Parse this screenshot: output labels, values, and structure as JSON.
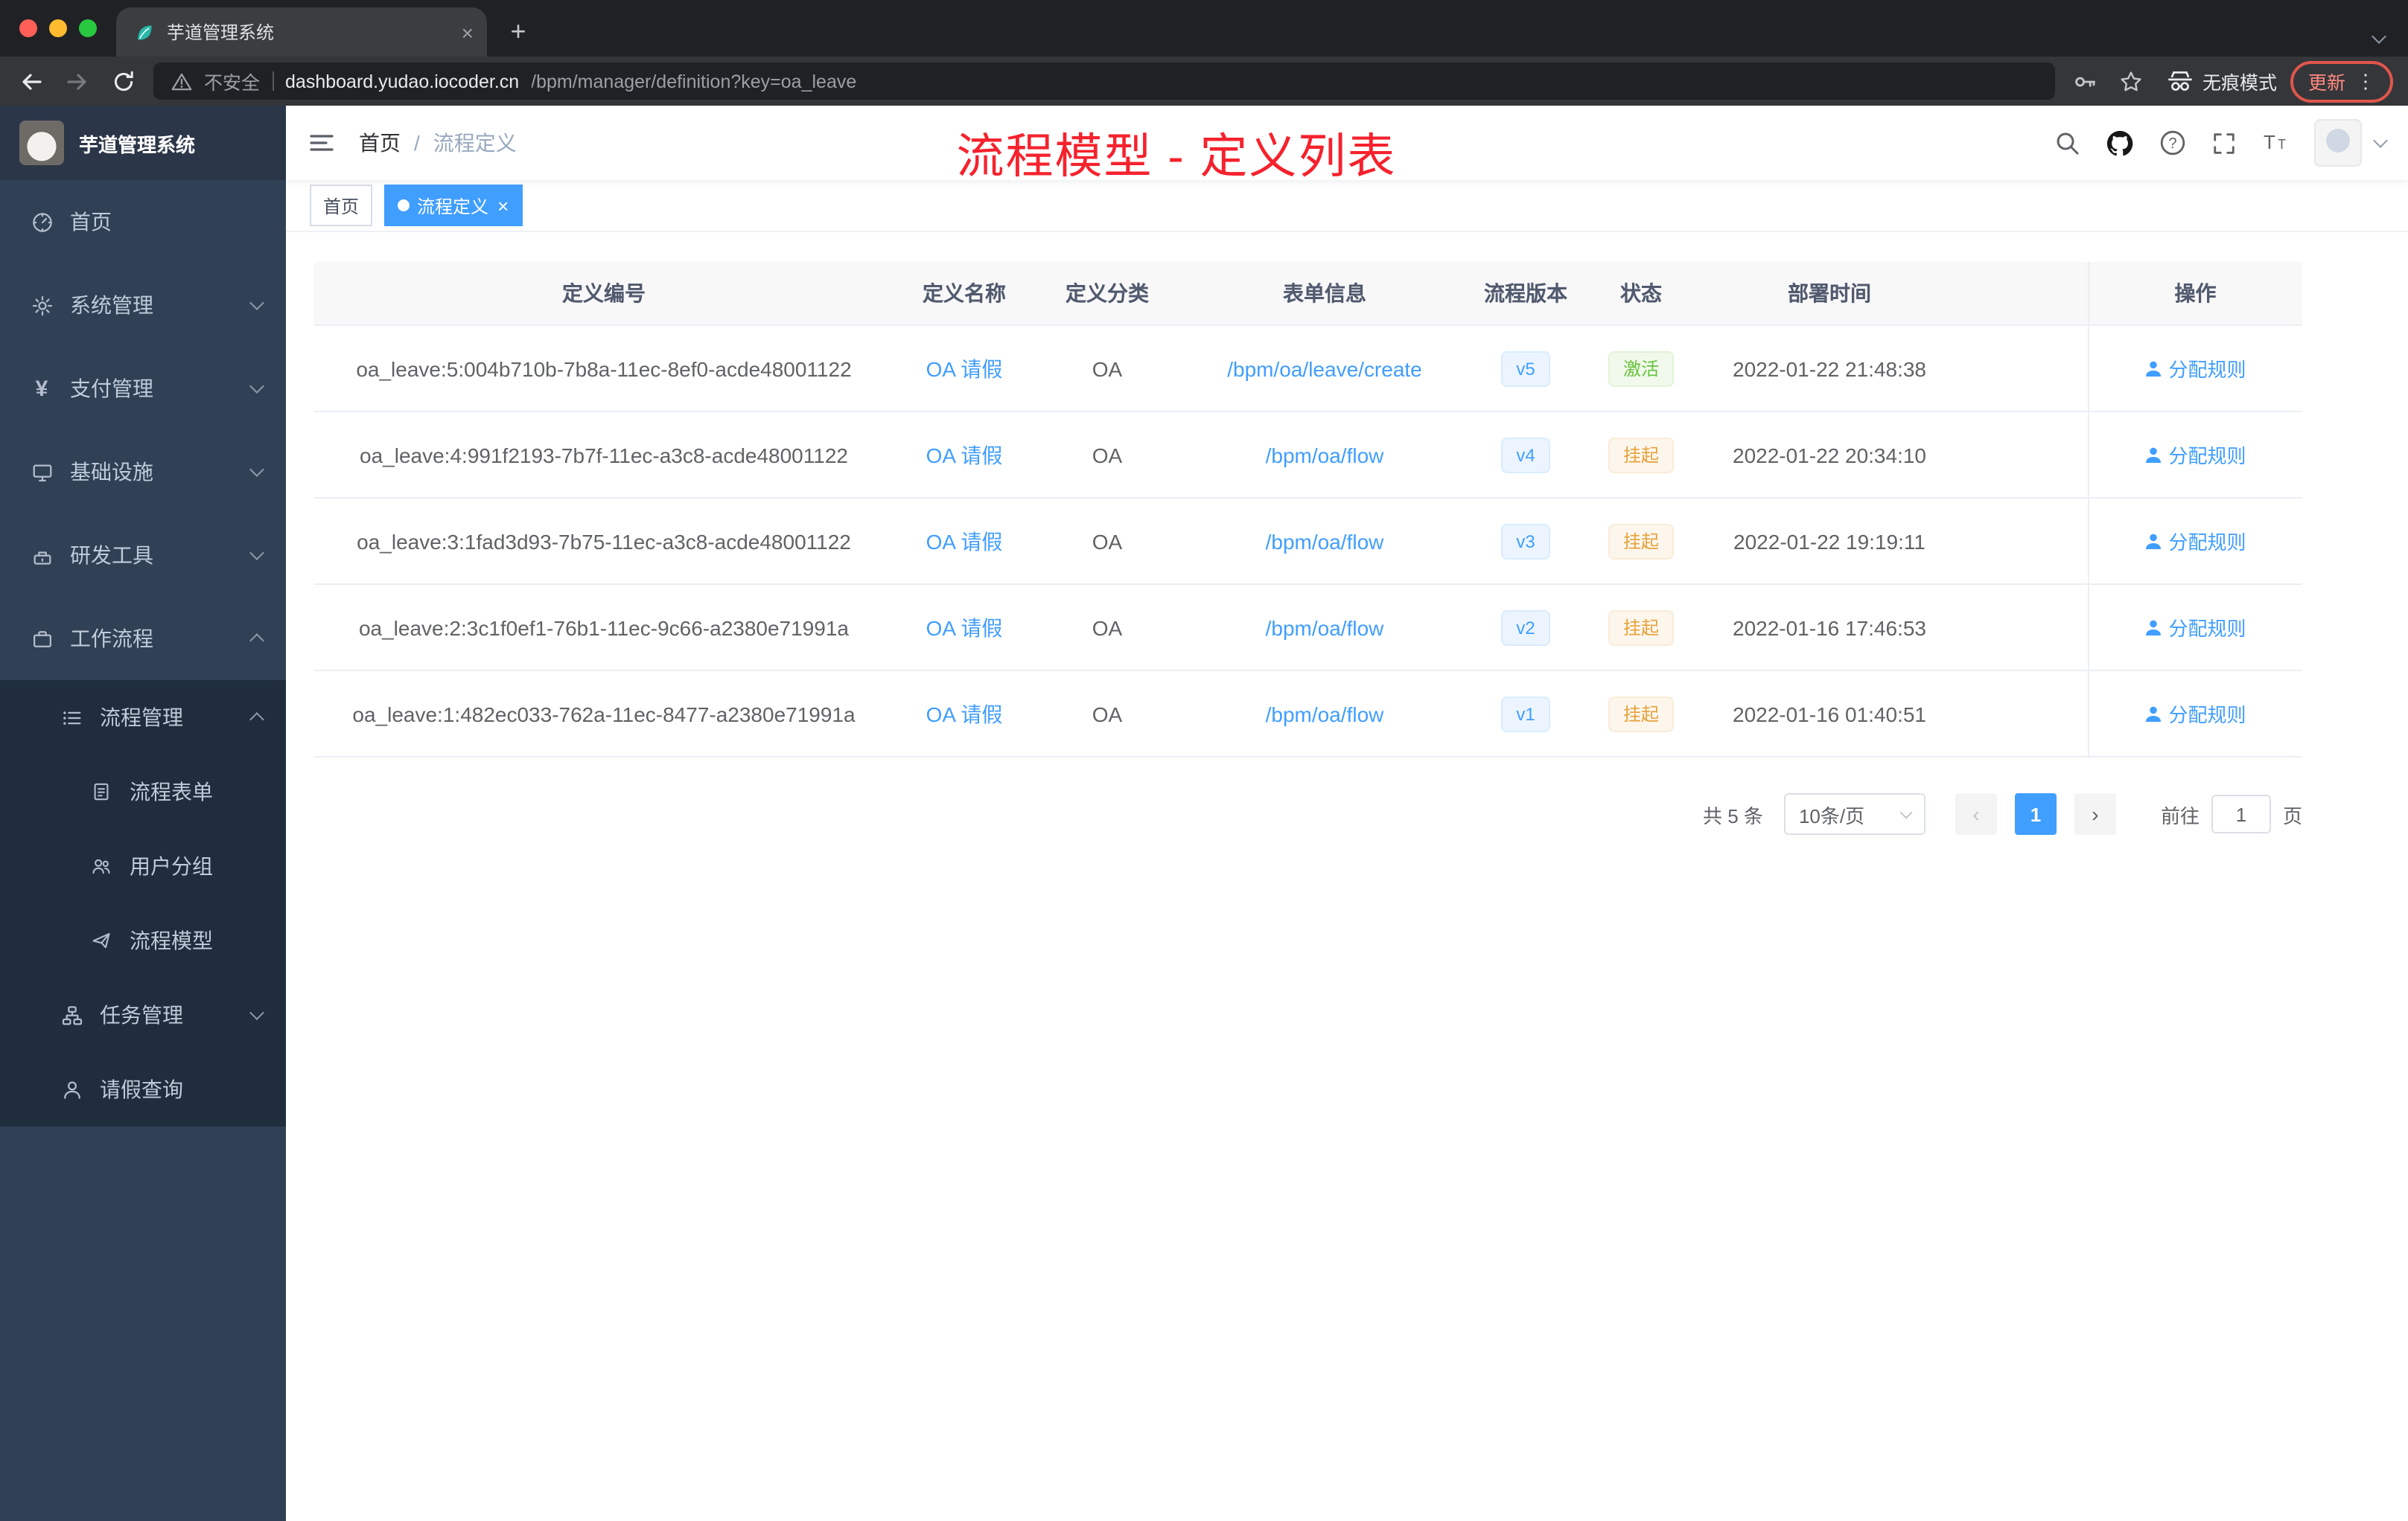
{
  "browser": {
    "tab_title": "芋道管理系统",
    "new_tab_glyph": "+",
    "close_glyph": "×",
    "security_label": "不安全",
    "url_host": "dashboard.yudao.iocoder.cn",
    "url_path": "/bpm/manager/definition?key=oa_leave",
    "incognito_label": "无痕模式",
    "update_label": "更新",
    "menu_dots_glyph": "⋮"
  },
  "sidebar": {
    "brand": "芋道管理系统",
    "items": [
      {
        "label": "首页"
      },
      {
        "label": "系统管理"
      },
      {
        "label": "支付管理"
      },
      {
        "label": "基础设施"
      },
      {
        "label": "研发工具"
      },
      {
        "label": "工作流程"
      }
    ],
    "submenu": {
      "process_mgmt": "流程管理",
      "process_form": "流程表单",
      "user_group": "用户分组",
      "process_model": "流程模型",
      "task_mgmt": "任务管理",
      "leave_query": "请假查询"
    },
    "yen_glyph": "¥"
  },
  "navbar": {
    "breadcrumb": [
      "首页",
      "流程定义"
    ],
    "separator": "/"
  },
  "annotation": {
    "text": "流程模型 - 定义列表",
    "color": "#f5222d"
  },
  "tags": [
    {
      "label": "首页",
      "active": false
    },
    {
      "label": "流程定义",
      "active": true
    }
  ],
  "table": {
    "columns": [
      "定义编号",
      "定义名称",
      "定义分类",
      "表单信息",
      "流程版本",
      "状态",
      "部署时间",
      "操作"
    ],
    "rows": [
      {
        "id": "oa_leave:5:004b710b-7b8a-11ec-8ef0-acde48001122",
        "name": "OA 请假",
        "category": "OA",
        "form": "/bpm/oa/leave/create",
        "version": "v5",
        "status": "激活",
        "status_type": "success",
        "time": "2022-01-22 21:48:38",
        "action": "分配规则"
      },
      {
        "id": "oa_leave:4:991f2193-7b7f-11ec-a3c8-acde48001122",
        "name": "OA 请假",
        "category": "OA",
        "form": "/bpm/oa/flow",
        "version": "v4",
        "status": "挂起",
        "status_type": "warning",
        "time": "2022-01-22 20:34:10",
        "action": "分配规则"
      },
      {
        "id": "oa_leave:3:1fad3d93-7b75-11ec-a3c8-acde48001122",
        "name": "OA 请假",
        "category": "OA",
        "form": "/bpm/oa/flow",
        "version": "v3",
        "status": "挂起",
        "status_type": "warning",
        "time": "2022-01-22 19:19:11",
        "action": "分配规则"
      },
      {
        "id": "oa_leave:2:3c1f0ef1-76b1-11ec-9c66-a2380e71991a",
        "name": "OA 请假",
        "category": "OA",
        "form": "/bpm/oa/flow",
        "version": "v2",
        "status": "挂起",
        "status_type": "warning",
        "time": "2022-01-16 17:46:53",
        "action": "分配规则"
      },
      {
        "id": "oa_leave:1:482ec033-762a-11ec-8477-a2380e71991a",
        "name": "OA 请假",
        "category": "OA",
        "form": "/bpm/oa/flow",
        "version": "v1",
        "status": "挂起",
        "status_type": "warning",
        "time": "2022-01-16 01:40:51",
        "action": "分配规则"
      }
    ]
  },
  "pagination": {
    "total": "共 5 条",
    "page_size": "10条/页",
    "prev_glyph": "‹",
    "next_glyph": "›",
    "current_page": "1",
    "goto_label": "前往",
    "goto_value": "1",
    "unit_label": "页"
  },
  "colors": {
    "accent": "#409eff",
    "success": "#67c23a",
    "warning": "#e6a23c",
    "annotation_red": "#f5222d",
    "sidebar_bg": "#304156",
    "submenu_bg": "#1f2d3d"
  }
}
